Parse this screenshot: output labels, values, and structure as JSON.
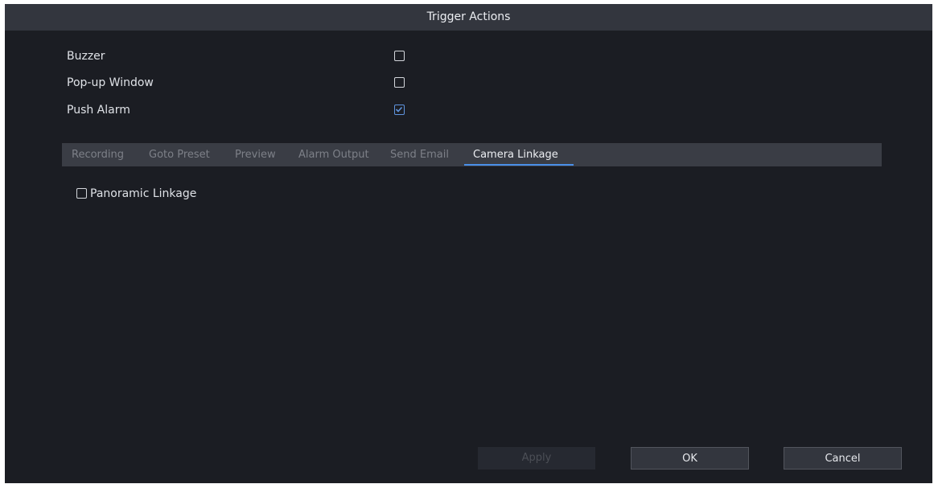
{
  "dialog": {
    "title": "Trigger Actions"
  },
  "options": [
    {
      "label": "Buzzer",
      "checked": false
    },
    {
      "label": "Pop-up Window",
      "checked": false
    },
    {
      "label": "Push Alarm",
      "checked": true
    }
  ],
  "tabs": [
    {
      "label": "Recording",
      "active": false
    },
    {
      "label": "Goto Preset",
      "active": false
    },
    {
      "label": "Preview",
      "active": false
    },
    {
      "label": "Alarm Output",
      "active": false
    },
    {
      "label": "Send Email",
      "active": false
    },
    {
      "label": "Camera Linkage",
      "active": true
    }
  ],
  "camera_linkage": {
    "panoramic_label": "Panoramic Linkage",
    "panoramic_checked": false
  },
  "buttons": {
    "apply": "Apply",
    "ok": "OK",
    "cancel": "Cancel"
  },
  "colors": {
    "background": "#1b1d23",
    "title_bar": "#33363e",
    "accent": "#4a8fe8"
  }
}
